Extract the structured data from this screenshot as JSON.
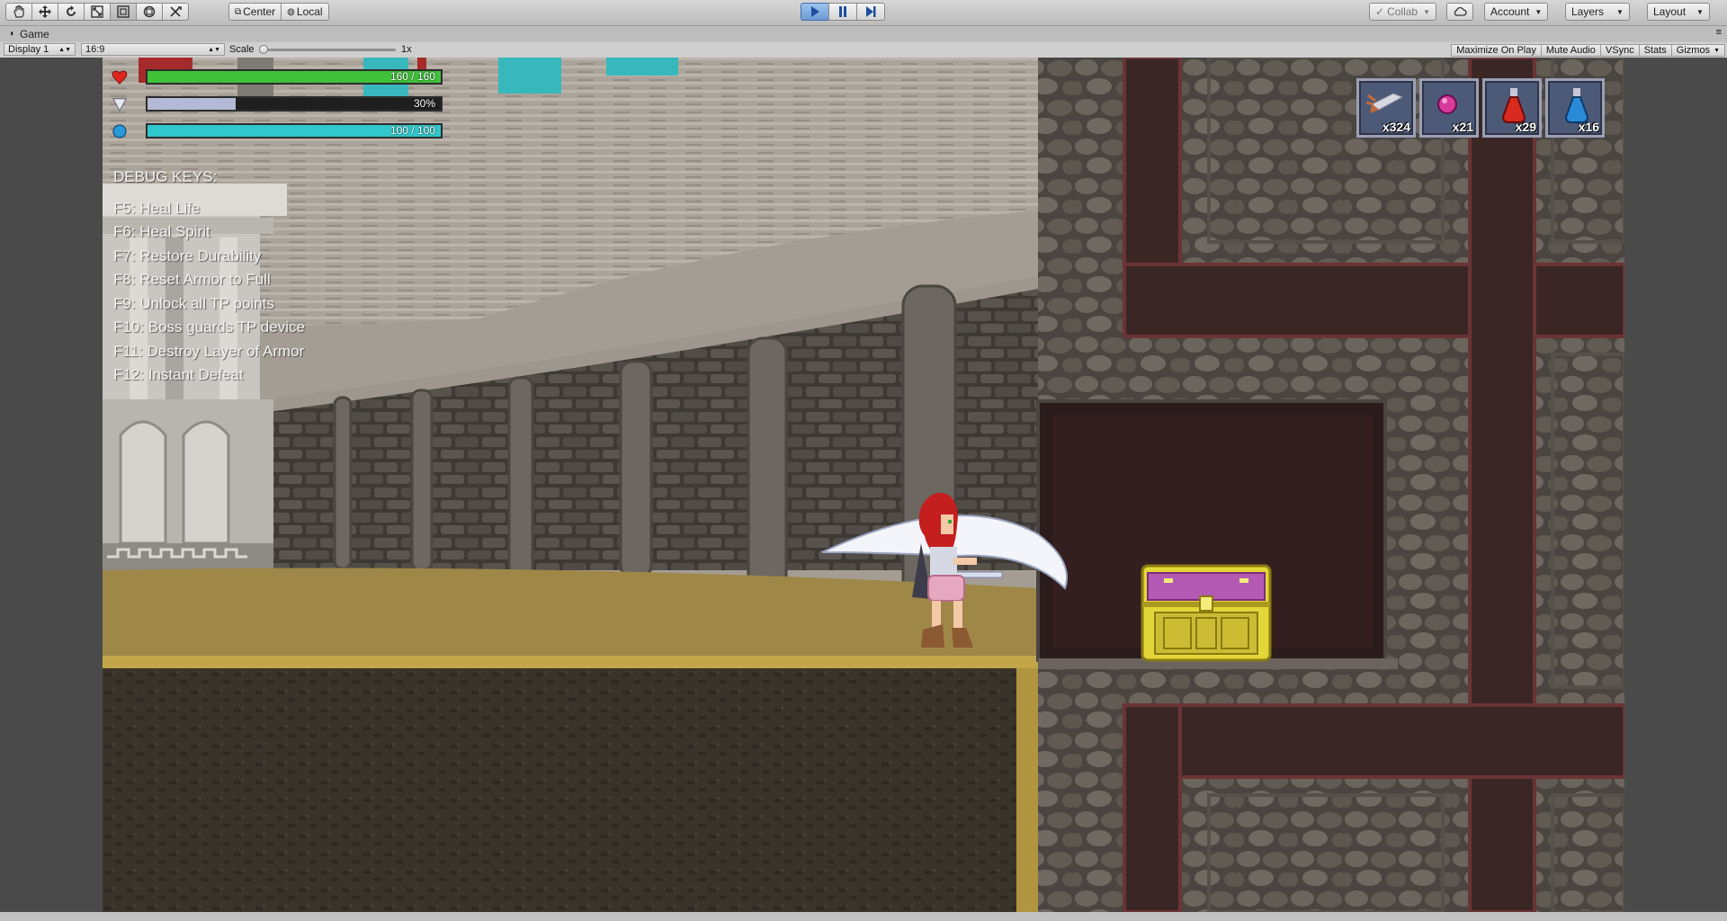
{
  "toolbar": {
    "pivot_label": "Center",
    "space_label": "Local",
    "collab_label": "Collab",
    "account_label": "Account",
    "layers_label": "Layers",
    "layout_label": "Layout"
  },
  "window": {
    "tab_label": "Game"
  },
  "game_options": {
    "display": "Display 1",
    "aspect": "16:9",
    "scale_label": "Scale",
    "scale_value": "1x",
    "maximize_on_play": "Maximize On Play",
    "mute_audio": "Mute Audio",
    "vsync": "VSync",
    "stats": "Stats",
    "gizmos": "Gizmos"
  },
  "hud": {
    "life": {
      "text": "160 / 160",
      "fraction": 1.0,
      "color": "#3fc23a"
    },
    "durability": {
      "text": "30%",
      "fraction": 0.3,
      "color": "#b4bad6"
    },
    "spirit": {
      "text": "100 / 100",
      "fraction": 1.0,
      "color": "#30c8cc"
    }
  },
  "debug": {
    "title": "DEBUG KEYS:",
    "lines": [
      "F5: Heal Life",
      "F6: Heal Spirit",
      "F7: Restore Durability",
      "F8: Reset Armor to Full",
      "F9: Unlock all TP points",
      "F10: Boss guards TP device",
      "F11: Destroy Layer of Armor",
      "F12: Instant Defeat"
    ]
  },
  "inventory": [
    {
      "icon": "bullet-icon",
      "count": "x324"
    },
    {
      "icon": "pink-orb-icon",
      "count": "x21"
    },
    {
      "icon": "red-potion-icon",
      "count": "x29"
    },
    {
      "icon": "blue-potion-icon",
      "count": "x16"
    }
  ],
  "colors": {
    "play_active": "#6d9bd4",
    "rock": "#5a554f",
    "wall_dark": "#3a2424",
    "chest_gold": "#e6dc3a",
    "chest_purple": "#b45ab4"
  }
}
